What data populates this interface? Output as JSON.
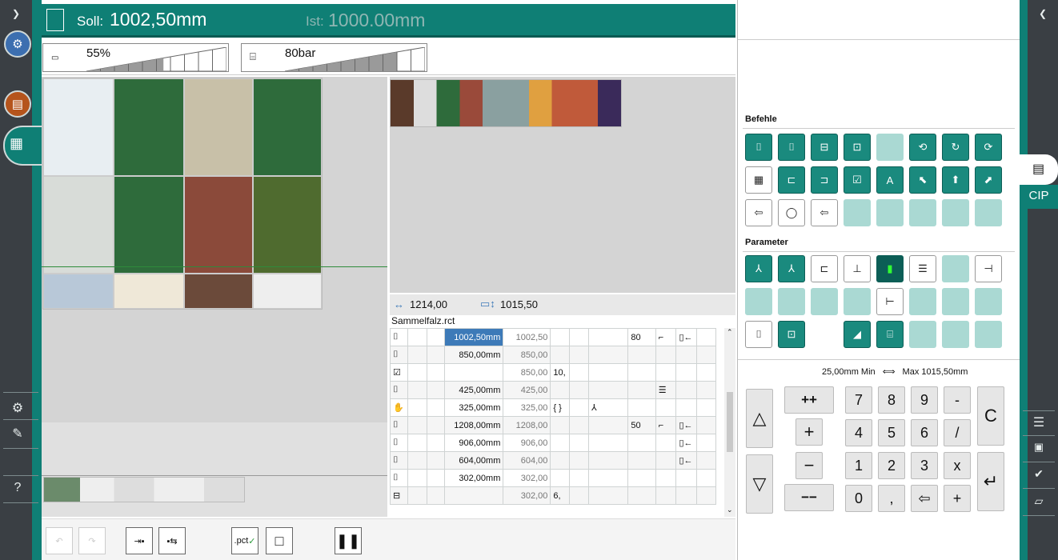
{
  "header": {
    "soll_label": "Soll:",
    "soll_value": "1002,50mm",
    "ist_label": "Ist:",
    "ist_value": "1000.00mm"
  },
  "gauges": {
    "clamp_speed": {
      "value": "55%",
      "level": 0.55
    },
    "clamp_pressure": {
      "value": "80bar",
      "level": 0.8
    }
  },
  "sheet": {
    "width": "1214,00",
    "height": "1015,50",
    "filename": "Sammelfalz.rct"
  },
  "program_rows": [
    {
      "soll": "1002,50mm",
      "ist": "1002,50",
      "extra": "",
      "pressure": "80",
      "selected": true
    },
    {
      "soll": "850,00mm",
      "ist": "850,00",
      "extra": "",
      "pressure": "",
      "selected": false
    },
    {
      "soll": "",
      "ist": "850,00",
      "extra": "10,",
      "pressure": "",
      "selected": false
    },
    {
      "soll": "425,00mm",
      "ist": "425,00",
      "extra": "",
      "pressure": "",
      "selected": false
    },
    {
      "soll": "325,00mm",
      "ist": "325,00",
      "extra": "{ }",
      "pressure": "",
      "selected": false
    },
    {
      "soll": "1208,00mm",
      "ist": "1208,00",
      "extra": "",
      "pressure": "50",
      "selected": false
    },
    {
      "soll": "906,00mm",
      "ist": "906,00",
      "extra": "",
      "pressure": "",
      "selected": false
    },
    {
      "soll": "604,00mm",
      "ist": "604,00",
      "extra": "",
      "pressure": "",
      "selected": false
    },
    {
      "soll": "302,00mm",
      "ist": "302,00",
      "extra": "",
      "pressure": "",
      "selected": false
    },
    {
      "soll": "",
      "ist": "302,00",
      "extra": "6,",
      "pressure": "",
      "selected": false
    }
  ],
  "right_panel": {
    "befehle_label": "Befehle",
    "parameter_label": "Parameter",
    "min_text": "25,00mm Min",
    "max_text": "Max  1015,50mm",
    "cip_tab": "CIP"
  },
  "keypad": {
    "step_up2": "++",
    "step_up": "+",
    "step_down": "−",
    "step_down2": "−−",
    "keys": [
      "7",
      "8",
      "9",
      "-",
      "4",
      "5",
      "6",
      "/",
      "1",
      "2",
      "3",
      "x",
      "0",
      ",",
      "⇦",
      "+"
    ],
    "clear": "C",
    "enter": "↵"
  },
  "toolbar": {
    "pct_label": ".pct"
  },
  "colors": {
    "teal": "#0f7f75",
    "teal_dark": "#0a5a53",
    "teal_light": "#aad9d3",
    "rail": "#3a3f44",
    "selected": "#3d7ab8"
  }
}
